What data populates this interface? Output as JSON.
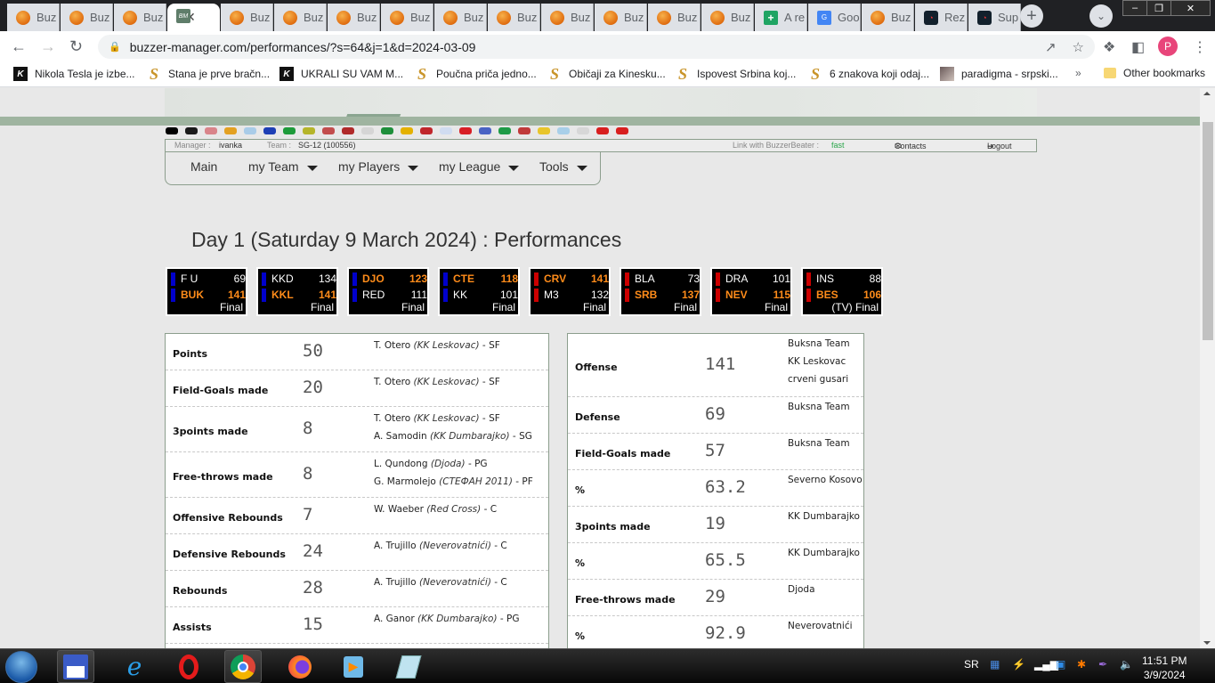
{
  "browser": {
    "tabs": [
      {
        "label": "Buz",
        "icon": "basketball-icon",
        "active": false
      },
      {
        "label": "Buz",
        "icon": "basketball-icon",
        "active": false
      },
      {
        "label": "Buz",
        "icon": "basketball-icon",
        "active": false
      },
      {
        "label": "BM",
        "icon": "buzzer-manager-icon",
        "active": true
      },
      {
        "label": "Buz",
        "icon": "basketball-icon",
        "active": false
      },
      {
        "label": "Buz",
        "icon": "basketball-icon",
        "active": false
      },
      {
        "label": "Buz",
        "icon": "basketball-icon",
        "active": false
      },
      {
        "label": "Buz",
        "icon": "basketball-icon",
        "active": false
      },
      {
        "label": "Buz",
        "icon": "basketball-icon",
        "active": false
      },
      {
        "label": "Buz",
        "icon": "basketball-icon",
        "active": false
      },
      {
        "label": "Buz",
        "icon": "basketball-icon",
        "active": false
      },
      {
        "label": "Buz",
        "icon": "basketball-icon",
        "active": false
      },
      {
        "label": "Buz",
        "icon": "basketball-icon",
        "active": false
      },
      {
        "label": "Buz",
        "icon": "basketball-icon",
        "active": false
      },
      {
        "label": "A re",
        "icon": "green-cross-icon",
        "active": false
      },
      {
        "label": "Goo",
        "icon": "google-translate-icon",
        "active": false
      },
      {
        "label": "Buz",
        "icon": "basketball-icon",
        "active": false
      },
      {
        "label": "Rez",
        "icon": "flashscore-icon",
        "active": false
      },
      {
        "label": "Sup",
        "icon": "flashscore-icon",
        "active": false
      }
    ],
    "new_tab_symbol": "+",
    "url": "buzzer-manager.com/performances/?s=64&j=1&d=2024-03-09",
    "profile_initial": "P",
    "bookmarks": [
      {
        "label": "Nikola Tesla je izbe...",
        "icon": "k"
      },
      {
        "label": "Stana je prve bračn...",
        "icon": "s"
      },
      {
        "label": "UKRALI SU VAM M...",
        "icon": "k"
      },
      {
        "label": "Poučna priča jedno...",
        "icon": "s"
      },
      {
        "label": "Običaji za Kinesku...",
        "icon": "s"
      },
      {
        "label": "Ispovest Srbina koj...",
        "icon": "s"
      },
      {
        "label": "6 znakova koji odaj...",
        "icon": "s"
      },
      {
        "label": "paradigma - srpski...",
        "icon": "img"
      }
    ],
    "more_bookmarks": "»",
    "other_bookmarks": "Other bookmarks"
  },
  "site": {
    "flags": [
      "#000000",
      "#1a1a1a",
      "#d9848a",
      "#e3a122",
      "#a9cce8",
      "#1d3fb5",
      "#1d9b3a",
      "#b5b52a",
      "#c24d4d",
      "#b02a2a",
      "#d5d5d5",
      "#1e8f3b",
      "#e4b100",
      "#c0262b",
      "#d0dcf0",
      "#d81f26",
      "#4a64c4",
      "#1e9b47",
      "#c03a3a",
      "#e8c52b",
      "#a8cfe9",
      "#d7d7d7",
      "#d81f1f",
      "#d81f1f"
    ],
    "info": {
      "manager_label": "Manager :",
      "manager": "ivanka",
      "team_label": "Team :",
      "team": "SG-12 (100556)",
      "link_label": "Link with BuzzerBeater :",
      "link_value": "fast",
      "contacts": "Contacts",
      "logout": "Logout"
    },
    "menu": [
      {
        "label": "Main",
        "dropdown": false
      },
      {
        "label": "my Team",
        "dropdown": true
      },
      {
        "label": "my Players",
        "dropdown": true
      },
      {
        "label": "my League",
        "dropdown": true
      },
      {
        "label": "Tools",
        "dropdown": true
      }
    ],
    "title": "Day 1 (Saturday 9 March 2024) : Performances",
    "colors": {
      "conference_a": "#0000cc",
      "conference_b": "#cc0000",
      "winner": "#ff8c1a",
      "link_fast": "#2aa64a"
    },
    "games": [
      {
        "conf": "a",
        "home": {
          "name": "F U",
          "pts": "69",
          "win": false
        },
        "away": {
          "name": "BUK",
          "pts": "141",
          "win": true
        },
        "status": "Final"
      },
      {
        "conf": "a",
        "home": {
          "name": "KKD",
          "pts": "134",
          "win": false
        },
        "away": {
          "name": "KKL",
          "pts": "141",
          "win": true
        },
        "status": "Final"
      },
      {
        "conf": "a",
        "home": {
          "name": "DJO",
          "pts": "123",
          "win": true
        },
        "away": {
          "name": "RED",
          "pts": "111",
          "win": false
        },
        "status": "Final"
      },
      {
        "conf": "a",
        "home": {
          "name": "CTE",
          "pts": "118",
          "win": true
        },
        "away": {
          "name": "KK",
          "pts": "101",
          "win": false
        },
        "status": "Final"
      },
      {
        "conf": "b",
        "home": {
          "name": "CRV",
          "pts": "141",
          "win": true
        },
        "away": {
          "name": "M3",
          "pts": "132",
          "win": false
        },
        "status": "Final"
      },
      {
        "conf": "b",
        "home": {
          "name": "BLA",
          "pts": "73",
          "win": false
        },
        "away": {
          "name": "SRB",
          "pts": "137",
          "win": true
        },
        "status": "Final"
      },
      {
        "conf": "b",
        "home": {
          "name": "DRA",
          "pts": "101",
          "win": false
        },
        "away": {
          "name": "NEV",
          "pts": "115",
          "win": true
        },
        "status": "Final"
      },
      {
        "conf": "b",
        "home": {
          "name": "INS",
          "pts": "88",
          "win": false
        },
        "away": {
          "name": "BES",
          "pts": "106",
          "win": true
        },
        "status": "(TV) Final"
      }
    ],
    "player_records": [
      {
        "label": "Points",
        "value": "50",
        "holders": [
          {
            "player": "T. Otero",
            "team": "KK Leskovac",
            "pos": "SF"
          }
        ]
      },
      {
        "label": "Field-Goals made",
        "value": "20",
        "holders": [
          {
            "player": "T. Otero",
            "team": "KK Leskovac",
            "pos": "SF"
          }
        ]
      },
      {
        "label": "3points made",
        "value": "8",
        "holders": [
          {
            "player": "T. Otero",
            "team": "KK Leskovac",
            "pos": "SF"
          },
          {
            "player": "A. Samodin",
            "team": "KK Dumbarajko",
            "pos": "SG"
          }
        ]
      },
      {
        "label": "Free-throws made",
        "value": "8",
        "holders": [
          {
            "player": "L. Qundong",
            "team": "Djoda",
            "pos": "PG"
          },
          {
            "player": "G. Marmolejo",
            "team": "СТЕФАН 2011",
            "pos": "PF"
          }
        ]
      },
      {
        "label": "Offensive Rebounds",
        "value": "7",
        "holders": [
          {
            "player": "W. Waeber",
            "team": "Red Cross",
            "pos": "C"
          }
        ]
      },
      {
        "label": "Defensive Rebounds",
        "value": "24",
        "holders": [
          {
            "player": "A. Trujillo",
            "team": "Neverovatnići",
            "pos": "C"
          }
        ]
      },
      {
        "label": "Rebounds",
        "value": "28",
        "holders": [
          {
            "player": "A. Trujillo",
            "team": "Neverovatnići",
            "pos": "C"
          }
        ]
      },
      {
        "label": "Assists",
        "value": "15",
        "holders": [
          {
            "player": "A. Ganor",
            "team": "KK Dumbarajko",
            "pos": "PG"
          }
        ]
      }
    ],
    "team_records": [
      {
        "label": "Offense",
        "value": "141",
        "teams": [
          "Buksna Team",
          "KK Leskovac",
          "crveni gusari"
        ]
      },
      {
        "label": "Defense",
        "value": "69",
        "teams": [
          "Buksna Team"
        ]
      },
      {
        "label": "Field-Goals made",
        "value": "57",
        "teams": [
          "Buksna Team"
        ]
      },
      {
        "label": "%",
        "value": "63.2",
        "teams": [
          "Severno Kosovo"
        ]
      },
      {
        "label": "3points made",
        "value": "19",
        "teams": [
          "KK Dumbarajko"
        ]
      },
      {
        "label": "%",
        "value": "65.5",
        "teams": [
          "KK Dumbarajko"
        ]
      },
      {
        "label": "Free-throws made",
        "value": "29",
        "teams": [
          "Djoda"
        ]
      },
      {
        "label": "%",
        "value": "92.9",
        "teams": [
          "Neverovatnići"
        ]
      }
    ]
  },
  "taskbar": {
    "apps": [
      "start-button",
      "floppy-app",
      "internet-explorer",
      "opera",
      "chrome",
      "firefox",
      "media-player",
      "notepad"
    ],
    "language": "SR",
    "time": "11:51 PM",
    "date": "3/9/2024"
  }
}
